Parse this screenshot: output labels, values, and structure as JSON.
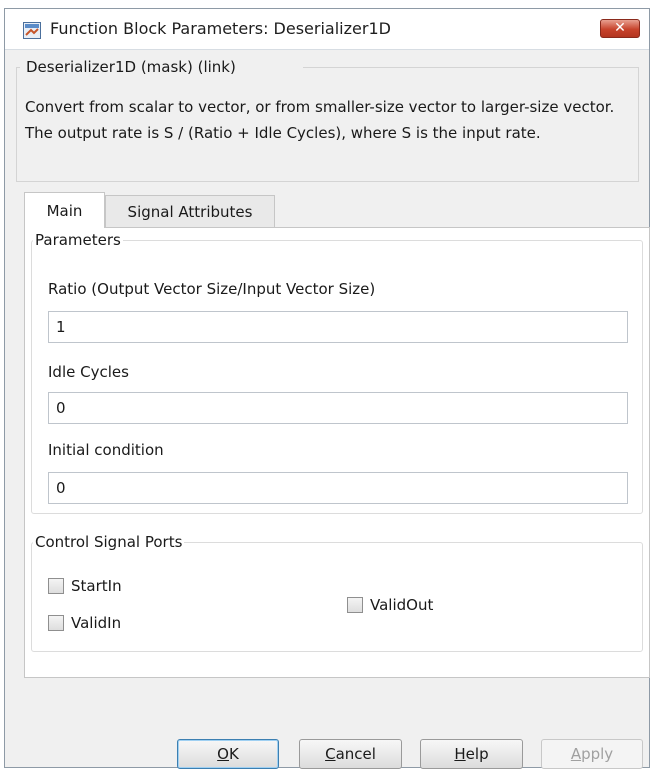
{
  "window": {
    "title": "Function Block Parameters: Deserializer1D",
    "close_glyph": "✕",
    "icon": "simulink-block-icon"
  },
  "mask": {
    "title": "Deserializer1D (mask) (link)",
    "description": "Convert from scalar to vector, or from smaller-size vector to larger-size vector. The output rate is S / (Ratio + Idle Cycles), where S is the input rate."
  },
  "tabs": [
    {
      "label": "Main",
      "selected": true
    },
    {
      "label": "Signal Attributes",
      "selected": false
    }
  ],
  "parameters": {
    "group_title": "Parameters",
    "fields": [
      {
        "label": "Ratio (Output Vector Size/Input Vector Size)",
        "value": "1"
      },
      {
        "label": "Idle Cycles",
        "value": "0"
      },
      {
        "label": "Initial condition",
        "value": "0"
      }
    ]
  },
  "control_ports": {
    "group_title": "Control Signal Ports",
    "checkboxes": [
      {
        "label": "StartIn",
        "checked": false
      },
      {
        "label": "ValidIn",
        "checked": false
      },
      {
        "label": "ValidOut",
        "checked": false
      }
    ]
  },
  "buttons": {
    "ok": {
      "mnemonic": "O",
      "rest": "K"
    },
    "cancel": {
      "mnemonic": "C",
      "rest": "ancel"
    },
    "help": {
      "mnemonic": "H",
      "rest": "elp"
    },
    "apply": {
      "mnemonic": "A",
      "rest": "pply",
      "enabled": false
    }
  },
  "colors": {
    "close_button": "#c7432c",
    "default_button_border": "#3c7fb1"
  }
}
